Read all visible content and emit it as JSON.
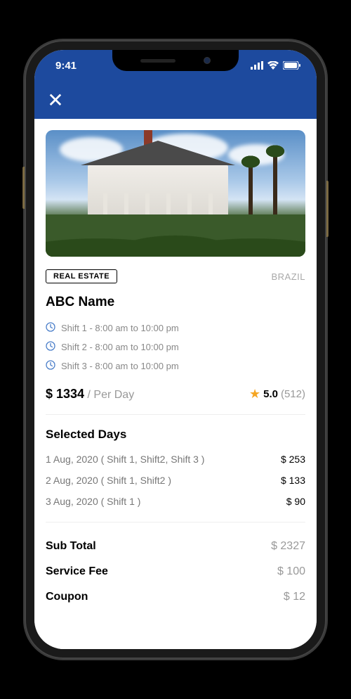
{
  "status": {
    "time": "9:41"
  },
  "header": {
    "close_glyph": "✕"
  },
  "listing": {
    "category": "REAL ESTATE",
    "location": "BRAZIL",
    "title": "ABC Name",
    "shifts": [
      "Shift 1 - 8:00 am to 10:00 pm",
      "Shift 2 - 8:00 am to 10:00 pm",
      "Shift 3 - 8:00 am to 10:00 pm"
    ],
    "price": "$ 1334",
    "price_unit": "/ Per Day",
    "rating": "5.0",
    "rating_count": "(512)"
  },
  "selected_days": {
    "title": "Selected Days",
    "items": [
      {
        "label": "1 Aug, 2020 ( Shift 1, Shift2, Shift 3 )",
        "amount": "$ 253"
      },
      {
        "label": "2 Aug, 2020 ( Shift 1, Shift2 )",
        "amount": "$ 133"
      },
      {
        "label": "3 Aug, 2020 ( Shift 1 )",
        "amount": "$ 90"
      }
    ]
  },
  "totals": {
    "subtotal_label": "Sub Total",
    "subtotal": "$ 2327",
    "fee_label": "Service Fee",
    "fee": "$ 100",
    "coupon_label": "Coupon",
    "coupon": "$ 12"
  }
}
